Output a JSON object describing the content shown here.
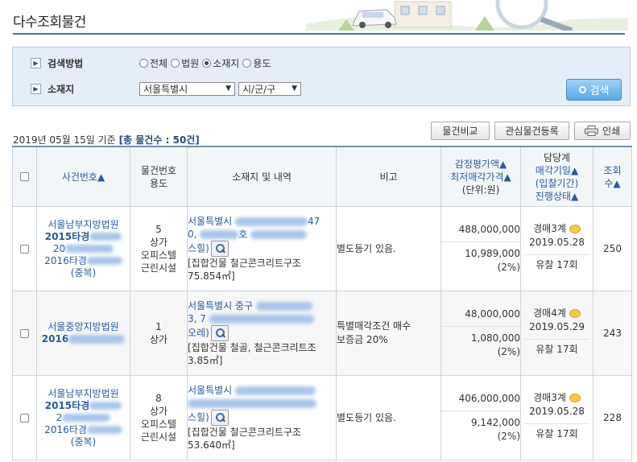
{
  "page": {
    "title": "다수조회물건"
  },
  "search": {
    "method_label": "검색방법",
    "location_label": "소재지",
    "radios": [
      {
        "label": "전체",
        "checked": false
      },
      {
        "label": "법원",
        "checked": false
      },
      {
        "label": "소재지",
        "checked": true
      },
      {
        "label": "용도",
        "checked": false
      }
    ],
    "city_select": "서울특별시",
    "district_select": "시/군/구",
    "search_button": "검색"
  },
  "summary": {
    "date_text": "2019년 05월 15일 기준",
    "total_text": "[총 물건수 : 50건]"
  },
  "toolbar": {
    "compare": "물건비교",
    "register": "관심물건등록",
    "print": "인쇄"
  },
  "table": {
    "headers": {
      "case_no": "사건번호▲",
      "item_no_1": "물건번호",
      "item_no_2": "용도",
      "location": "소재지 및 내역",
      "remark": "비고",
      "price_1": "감정평가액▲",
      "price_2": "최저매각가격▲",
      "price_3": "(단위:원)",
      "status_1": "담당계",
      "status_2": "매각기일▲",
      "status_3": "(입찰기간)",
      "status_4": "진행상태▲",
      "views_1": "조회",
      "views_2": "수▲"
    },
    "rows": [
      {
        "court": "서울남부지방법원",
        "case_a": "2015타경",
        "case_b": "20",
        "case_c": "2016타경",
        "dup": "(중복)",
        "item_no": "5",
        "use1": "상가",
        "use2": "오피스텔",
        "use3": "근린시설",
        "addr1": "서울특별시",
        "addr_tail1": "47",
        "addr2a": "0,",
        "addr2b": "호",
        "addr3": "스힐)",
        "detail": "[집합건물 철근콘크리트구조 75.854㎡]",
        "remark1": "별도등기 있음.",
        "remark2": "",
        "appraisal": "488,000,000",
        "minimum": "10,989,000",
        "percent": "(2%)",
        "dept": "경매3계",
        "date": "2019.05.28",
        "status": "유찰 17회",
        "views": "250"
      },
      {
        "court": "서울중앙지방법원",
        "case_a": "2016",
        "case_b": "",
        "case_c": "",
        "dup": "",
        "item_no": "1",
        "use1": "상가",
        "use2": "",
        "use3": "",
        "addr1": "서울특별시 중구",
        "addr_tail1": "",
        "addr2a": "3, 7",
        "addr2b": "",
        "addr3": "오레)",
        "detail": "[집합건물 철골, 철근콘크리트조 3.85㎡]",
        "remark1": "특별매각조건 매수",
        "remark2": "보증금 20%",
        "appraisal": "48,000,000",
        "minimum": "1,080,000",
        "percent": "(2%)",
        "dept": "경매4계",
        "date": "2019.05.29",
        "status": "유찰 17회",
        "views": "243"
      },
      {
        "court": "서울남부지방법원",
        "case_a": "2015타경",
        "case_b": "2",
        "case_c": "2016타경",
        "dup": "(중복)",
        "item_no": "8",
        "use1": "상가",
        "use2": "오피스텔",
        "use3": "근린시설",
        "addr1": "서울특별시",
        "addr_tail1": "",
        "addr2a": "",
        "addr2b": "",
        "addr3": "스힐)",
        "detail": "[집합건물 철근콘크리트구조 53.640㎡]",
        "remark1": "별도등기 있음.",
        "remark2": "",
        "appraisal": "406,000,000",
        "minimum": "9,142,000",
        "percent": "(2%)",
        "dept": "경매3계",
        "date": "2019.05.28",
        "status": "유찰 17회",
        "views": "228"
      }
    ]
  }
}
